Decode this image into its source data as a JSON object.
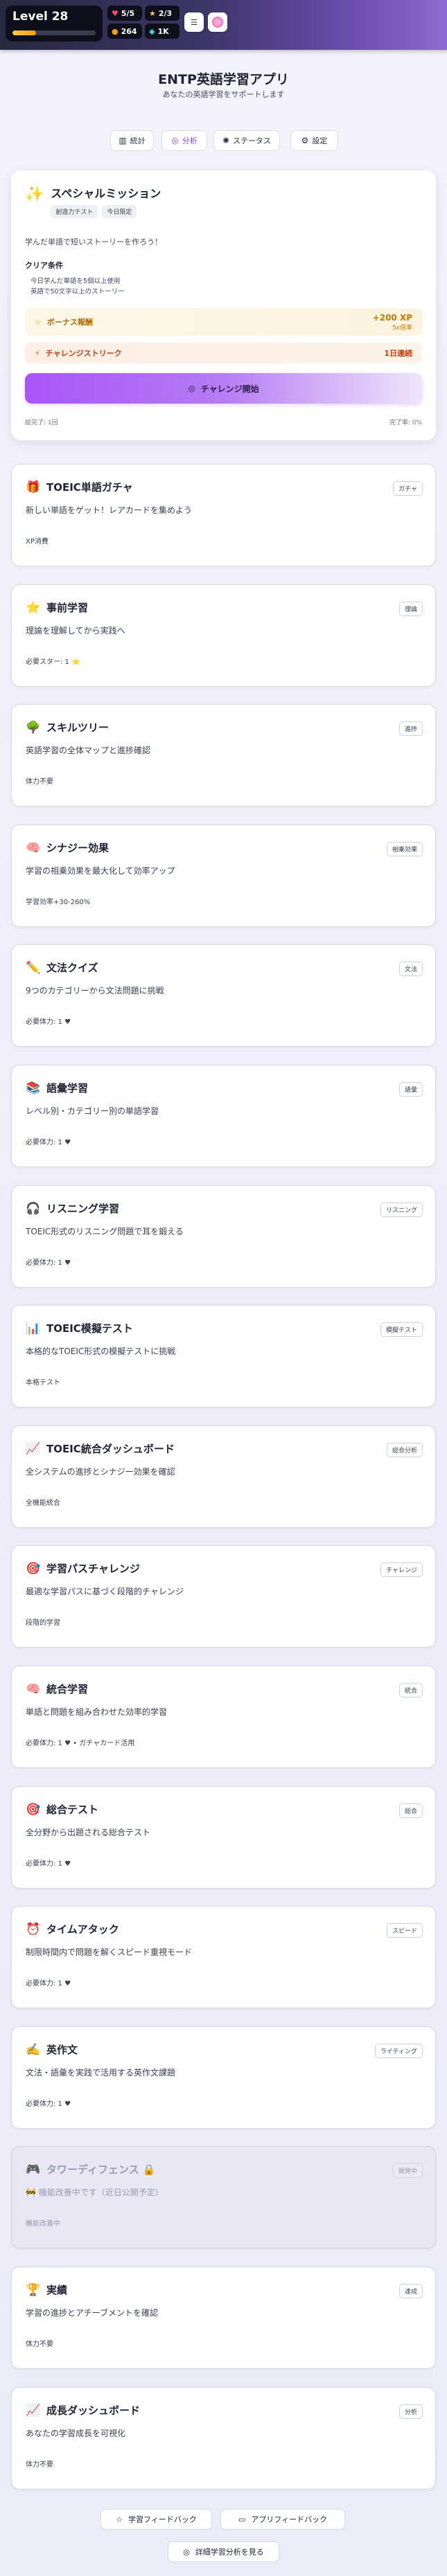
{
  "header": {
    "level_label": "Level 28",
    "xp_progress": 0.28,
    "stats": {
      "hearts": "5/5",
      "stars": "2/3",
      "coins": "264",
      "gems": "1K"
    },
    "icons": {
      "heart": "heart-icon",
      "star": "star-icon",
      "coin": "coin-icon",
      "gem": "gem-icon"
    }
  },
  "app": {
    "title": "ENTP英語学習アプリ",
    "subtitle": "あなたの英語学習をサポートします"
  },
  "nav": [
    {
      "label": "統計",
      "icon": "chart-icon"
    },
    {
      "label": "分析",
      "icon": "analysis-icon"
    },
    {
      "label": "ステータス",
      "icon": "status-icon"
    },
    {
      "label": "設定",
      "icon": "gear-icon"
    }
  ],
  "mission": {
    "title": "スペシャルミッション",
    "tags": [
      "創造力テスト",
      "今日限定"
    ],
    "description": "学んだ単語で短いストーリーを作ろう！",
    "condition_title": "クリア条件",
    "conditions": [
      "今日学んだ単語を5個以上使用",
      "英語で50文字以上のストーリー"
    ],
    "bonus_label": "ボーナス報酬",
    "bonus_xp": "+200 XP",
    "bonus_time": "5x倍率",
    "streak_label": "チャレンジストリーク",
    "streak_value": "1日連続",
    "challenge_button": "チャレンジ開始",
    "completed_label": "総完了: 1回",
    "completion_rate": "完了率: 0%"
  },
  "cards": [
    {
      "icon": "🎁",
      "title": "TOEIC単語ガチャ",
      "badge": "ガチャ",
      "desc": "新しい単語をゲット！レアカードを集めよう",
      "meta": "XP消費"
    },
    {
      "icon": "⭐",
      "title": "事前学習",
      "badge": "理論",
      "desc": "理論を理解してから実践へ",
      "meta": "必要スター: 1 ⭐"
    },
    {
      "icon": "🌳",
      "title": "スキルツリー",
      "badge": "進捗",
      "desc": "英語学習の全体マップと進捗確認",
      "meta": "体力不要"
    },
    {
      "icon": "🧠",
      "title": "シナジー効果",
      "badge": "相乗効果",
      "desc": "学習の相乗効果を最大化して効率アップ",
      "meta": "学習効率+30-260%"
    },
    {
      "icon": "✏️",
      "title": "文法クイズ",
      "badge": "文法",
      "desc": "9つのカテゴリーから文法問題に挑戦",
      "meta": "必要体力: 1 ♥"
    },
    {
      "icon": "📚",
      "title": "語彙学習",
      "badge": "語彙",
      "desc": "レベル別・カテゴリー別の単語学習",
      "meta": "必要体力: 1 ♥"
    },
    {
      "icon": "🎧",
      "title": "リスニング学習",
      "badge": "リスニング",
      "desc": "TOEIC形式のリスニング問題で耳を鍛える",
      "meta": "必要体力: 1 ♥"
    },
    {
      "icon": "📊",
      "title": "TOEIC模擬テスト",
      "badge": "模擬テスト",
      "desc": "本格的なTOEIC形式の模擬テストに挑戦",
      "meta": "本格テスト"
    },
    {
      "icon": "📈",
      "title": "TOEIC統合ダッシュボード",
      "badge": "総合分析",
      "desc": "全システムの進捗とシナジー効果を確認",
      "meta": "全機能統合"
    },
    {
      "icon": "🎯",
      "title": "学習パスチャレンジ",
      "badge": "チャレンジ",
      "desc": "最適な学習パスに基づく段階的チャレンジ",
      "meta": "段階的学習"
    },
    {
      "icon": "🧠",
      "title": "統合学習",
      "badge": "統合",
      "desc": "単語と問題を組み合わせた効率的学習",
      "meta": "必要体力: 1 ♥ • ガチャカード活用"
    },
    {
      "icon": "🎯",
      "title": "総合テスト",
      "badge": "総合",
      "desc": "全分野から出題される総合テスト",
      "meta": "必要体力: 1 ♥"
    },
    {
      "icon": "⏰",
      "title": "タイムアタック",
      "badge": "スピード",
      "desc": "制限時間内で問題を解くスピード重視モード",
      "meta": "必要体力: 1 ♥"
    },
    {
      "icon": "✍️",
      "title": "英作文",
      "badge": "ライティング",
      "desc": "文法・語彙を実践で活用する英作文課題",
      "meta": "必要体力: 1 ♥"
    },
    {
      "icon": "🎮",
      "title": "タワーディフェンス 🔒",
      "badge": "開発中",
      "desc": "🚧 機能改善中です（近日公開予定）",
      "meta": "機能改善中",
      "locked": true
    },
    {
      "icon": "🏆",
      "title": "実績",
      "badge": "達成",
      "desc": "学習の進捗とアチーブメントを確認",
      "meta": "体力不要"
    },
    {
      "icon": "📈",
      "title": "成長ダッシュボード",
      "badge": "分析",
      "desc": "あなたの学習成長を可視化",
      "meta": "体力不要"
    }
  ],
  "footer": {
    "feedback_learning": "学習フィードバック",
    "feedback_app": "アプリフィードバック",
    "detail_analysis": "詳細学習分析を見る"
  }
}
